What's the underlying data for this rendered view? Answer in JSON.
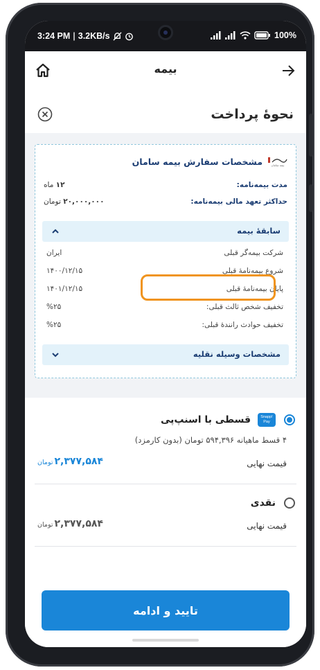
{
  "colors": {
    "accent": "#1a86d8",
    "navy": "#1b3d73",
    "highlight": "#f0941e",
    "panel": "#f1f3f6"
  },
  "status": {
    "time": "3:24 PM",
    "speed": "3.2KB/s",
    "battery": "100%"
  },
  "topbar": {
    "title": "بیمه",
    "back_icon": "arrow-right-icon",
    "home_icon": "home-icon"
  },
  "sheet": {
    "title": "نحوهٔ پرداخت",
    "close_icon": "close-circle-icon"
  },
  "order": {
    "title": "مشخصات سفارش بیمه سامان",
    "brand_text": "بیمه سامان",
    "duration_label": "مدت بیمه‌نامه:",
    "duration_value": "۱۲",
    "duration_unit": "ماه",
    "max_label": "حداکثر تعهد مالی بیمه‌نامه:",
    "max_value": "۲۰,۰۰۰,۰۰۰",
    "max_unit": "تومان"
  },
  "history": {
    "title": "سابقهٔ بیمه",
    "rows": [
      {
        "label": "شرکت بیمه‌گر قبلی",
        "value": "ایران"
      },
      {
        "label": "شروع بیمه‌نامهٔ قبلی",
        "value": "۱۴۰۰/۱۲/۱۵"
      },
      {
        "label": "پایان بیمه‌نامهٔ قبلی",
        "value": "۱۴۰۱/۱۲/۱۵"
      },
      {
        "label": "تخفیف شخص ثالث قبلی:",
        "value": "%۲۵"
      },
      {
        "label": "تخفیف حوادث رانندهٔ قبلی:",
        "value": "%۲۵"
      }
    ]
  },
  "vehicle": {
    "title": "مشخصات وسیله نقلیه"
  },
  "payment": {
    "snapp": {
      "title": "قسطی با اسنپ‌پی",
      "badge_line1": "Snapp!",
      "badge_line2": "Pay",
      "description": "۴ قسط ماهیانه ۵۹۴,۳۹۶ تومان (بدون کارمزد)",
      "price_label": "قیمت نهایی",
      "price_value": "۲,۳۷۷,۵۸۴",
      "currency": "تومان",
      "selected": true
    },
    "cash": {
      "title": "نقدی",
      "price_label": "قیمت نهایی",
      "price_value": "۲,۳۷۷,۵۸۴",
      "currency": "تومان",
      "selected": false
    }
  },
  "confirm": {
    "label": "تایید و ادامه"
  }
}
